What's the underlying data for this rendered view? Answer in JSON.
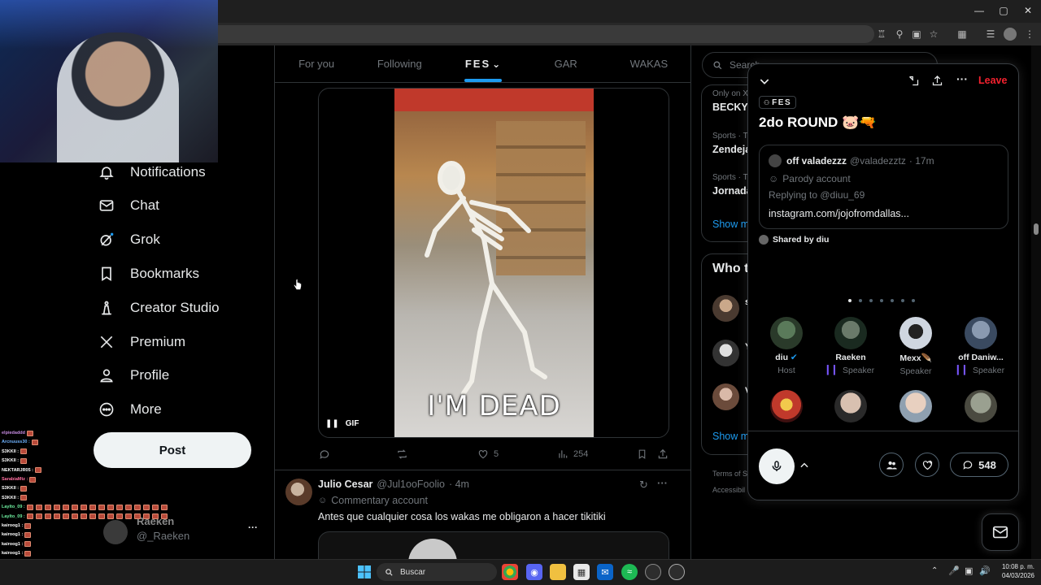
{
  "browser": {
    "window_controls": {
      "minimize": "—",
      "maximize": "▢",
      "close": "✕"
    }
  },
  "sidebar": {
    "items": [
      {
        "label": "Notifications",
        "icon": "bell-icon"
      },
      {
        "label": "Chat",
        "icon": "mail-icon"
      },
      {
        "label": "Grok",
        "icon": "grok-icon"
      },
      {
        "label": "Bookmarks",
        "icon": "bookmark-icon"
      },
      {
        "label": "Creator Studio",
        "icon": "creator-studio-icon"
      },
      {
        "label": "Premium",
        "icon": "x-logo-icon"
      },
      {
        "label": "Profile",
        "icon": "person-icon"
      },
      {
        "label": "More",
        "icon": "more-circle-icon"
      }
    ],
    "post_label": "Post",
    "account": {
      "name": "Raeken",
      "handle": "@_Raeken",
      "menu": "···"
    }
  },
  "stream_chat": [
    {
      "user": "elpiedaddd",
      "color": "#c48ae0"
    },
    {
      "user": "Arcnuuss30 :",
      "color": "#6fb3ff"
    },
    {
      "user": "S3KKII :",
      "color": "#ffffff"
    },
    {
      "user": "S3KKII :",
      "color": "#ffffff"
    },
    {
      "user": "NEKTARJR05 :",
      "color": "#ffffff"
    },
    {
      "user": "SarabiaMtz :",
      "color": "#ff6fa0"
    },
    {
      "user": "S3KKII :",
      "color": "#ffffff"
    },
    {
      "user": "S3KKII :",
      "color": "#ffffff"
    },
    {
      "user": "Laylto_09 :",
      "color": "#6ff0a0"
    },
    {
      "user": "Laylto_09 :",
      "color": "#6ff0a0"
    },
    {
      "user": "kairoog1 :",
      "color": "#ffffff"
    },
    {
      "user": "kairoog1 :",
      "color": "#ffffff"
    },
    {
      "user": "kairoog1 :",
      "color": "#ffffff"
    },
    {
      "user": "kairoog1 :",
      "color": "#ffffff"
    },
    {
      "user": "kairoog1 :",
      "color": "#ffffff"
    }
  ],
  "timeline": {
    "tabs": [
      {
        "label": "For you"
      },
      {
        "label": "Following"
      },
      {
        "label": "FES",
        "chevron": "⌄"
      },
      {
        "label": "GAR"
      },
      {
        "label": "WAKAS"
      }
    ],
    "active_tab": "FES",
    "post1": {
      "gif_caption": "I'M DEAD",
      "gif_badge": "GIF",
      "likes": "5",
      "views": "254"
    },
    "post2": {
      "name": "Julio Cesar",
      "handle": "@Jul1ooFoolio",
      "time": "· 4m",
      "label": "Commentary account",
      "text": "Antes que cualquier cosa los wakas me obligaron a hacer tikitiki"
    }
  },
  "right": {
    "search_placeholder": "Search",
    "trends": [
      {
        "meta": "Only on X",
        "title": "BECKY"
      },
      {
        "meta": "Sports · T",
        "title": "Zendeja"
      },
      {
        "meta": "Sports · T",
        "title": "Jornada"
      }
    ],
    "show_more": "Show m",
    "who_to_follow": "Who t",
    "wtf_initials": [
      "s",
      "Y",
      "V"
    ],
    "footer": [
      "Terms of S",
      "Accessibil"
    ]
  },
  "space": {
    "leave": "Leave",
    "tag": "FES",
    "title": "2do ROUND 🐷🔫",
    "pinned": {
      "name": "off valadezzz",
      "handle": "@valadezztz",
      "time": "· 17m",
      "label": "Parody account",
      "replying": "Replying to @diuu_69",
      "link": "instagram.com/jojofromdallas..."
    },
    "shared_by": "Shared by diu",
    "speakers": [
      {
        "name": "diu",
        "role": "Host",
        "verified": true
      },
      {
        "name": "Raeken",
        "role": "Speaker",
        "speaking": true
      },
      {
        "name": "Mexx🪶",
        "role": "Speaker",
        "speaking": false
      },
      {
        "name": "off Daniw...",
        "role": "Speaker",
        "speaking": true
      }
    ],
    "comment_count": "548"
  },
  "taskbar": {
    "search_label": "Buscar",
    "time": "10:08 p. m.",
    "date": "04/03/2026"
  }
}
